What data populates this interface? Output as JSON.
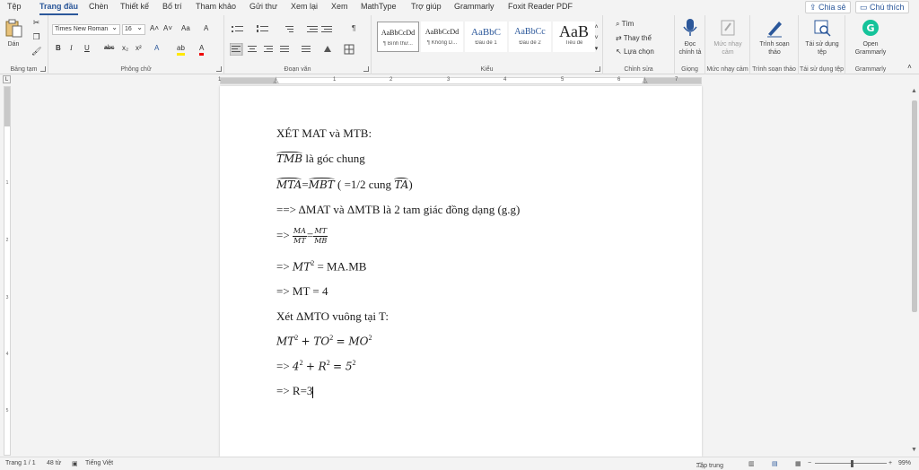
{
  "menu": {
    "tabs": [
      "Tệp",
      "Trang đầu",
      "Chèn",
      "Thiết kế",
      "Bố trí",
      "Tham khảo",
      "Gửi thư",
      "Xem lại",
      "Xem",
      "MathType",
      "Trợ giúp",
      "Grammarly",
      "Foxit Reader PDF"
    ],
    "active_tab": "Trang đầu",
    "share": "Chia sẻ",
    "comments": "Chú thích"
  },
  "ribbon": {
    "clipboard": {
      "paste": "Dán",
      "label": "Bảng tạm"
    },
    "font": {
      "name": "Times New Roman",
      "size": "16",
      "label": "Phông chữ",
      "bold": "B",
      "italic": "I",
      "underline": "U",
      "strike": "abc",
      "sub": "x₂",
      "sup": "x²",
      "grow": "A˄",
      "shrink": "A˅",
      "case": "Aa",
      "clear": "A",
      "effects": "A",
      "highlight": "ab",
      "color": "A"
    },
    "paragraph": {
      "label": "Đoạn văn",
      "marks": "¶"
    },
    "styles": {
      "label": "Kiểu",
      "items": [
        {
          "preview": "AaBbCcDd",
          "name": "¶ Bình thư..."
        },
        {
          "preview": "AaBbCcDd",
          "name": "¶ Không D..."
        },
        {
          "preview": "AaBbC",
          "name": "Đầu đề 1"
        },
        {
          "preview": "AaBbCc",
          "name": "Đầu đề 2"
        },
        {
          "preview": "AaB",
          "name": "Tiêu đề"
        }
      ]
    },
    "editing": {
      "find": "Tìm",
      "replace": "Thay thế",
      "select": "Lựa chọn",
      "label": "Chỉnh sửa"
    },
    "voice": {
      "dictate": "Đọc chính tả",
      "label": "Giọng"
    },
    "sensitivity": {
      "button": "Mức nhạy cảm",
      "label": "Mức nhạy cảm"
    },
    "editor": {
      "button": "Trình soạn thảo",
      "label": "Trình soạn thảo"
    },
    "reuse": {
      "button": "Tái sử dụng tệp",
      "label": "Tái sử dụng tệp"
    },
    "grammarly": {
      "button": "Open Grammarly",
      "label": "Grammarly"
    }
  },
  "ruler": {
    "numbers": [
      "1",
      "1",
      "2",
      "3",
      "4",
      "5",
      "6",
      "7"
    ]
  },
  "vruler": {
    "numbers": [
      "1",
      "2",
      "3",
      "4",
      "5"
    ]
  },
  "document": {
    "line1": "XÉT MAT và MTB:",
    "line2_arc": "TMB",
    "line2_text": "là góc chung",
    "line3_arc1": "MTA",
    "line3_eq": "=",
    "line3_arc2": "MBT",
    "line3_text": "( =1/2 cung",
    "line3_arc3": "TA",
    "line3_end": ")",
    "line4": "==> ΔMAT và ΔMTB là 2 tam giác đồng dạng (g.g)",
    "line5_prefix": "=>",
    "line5_num1": "MA",
    "line5_den1": "MT",
    "line5_eq": "=",
    "line5_num2": "MT",
    "line5_den2": "MB",
    "line6_prefix": "=>",
    "line6_math": "MT",
    "line6_sup": "2",
    "line6_rest": "= MA.MB",
    "line7": "=> MT = 4",
    "line8": "Xét ΔMTO vuông tại T:",
    "line9_a": "MT",
    "line9_sup1": "2",
    "line9_b": "+ TO",
    "line9_sup2": "2",
    "line9_c": "= MO",
    "line9_sup3": "2",
    "line10_prefix": "=>",
    "line10_a": "4",
    "line10_sup1": "2",
    "line10_b": "+ R",
    "line10_sup2": "2",
    "line10_c": "= 5",
    "line10_sup3": "2",
    "line11": "=> R=3"
  },
  "status": {
    "page": "Trang 1 / 1",
    "words": "48 từ",
    "language": "Tiếng Việt",
    "focus": "Tập trung",
    "zoom": "99%"
  },
  "colors": {
    "accent": "#2b579a",
    "grammarly": "#15c39a",
    "spell": "#c00000"
  }
}
